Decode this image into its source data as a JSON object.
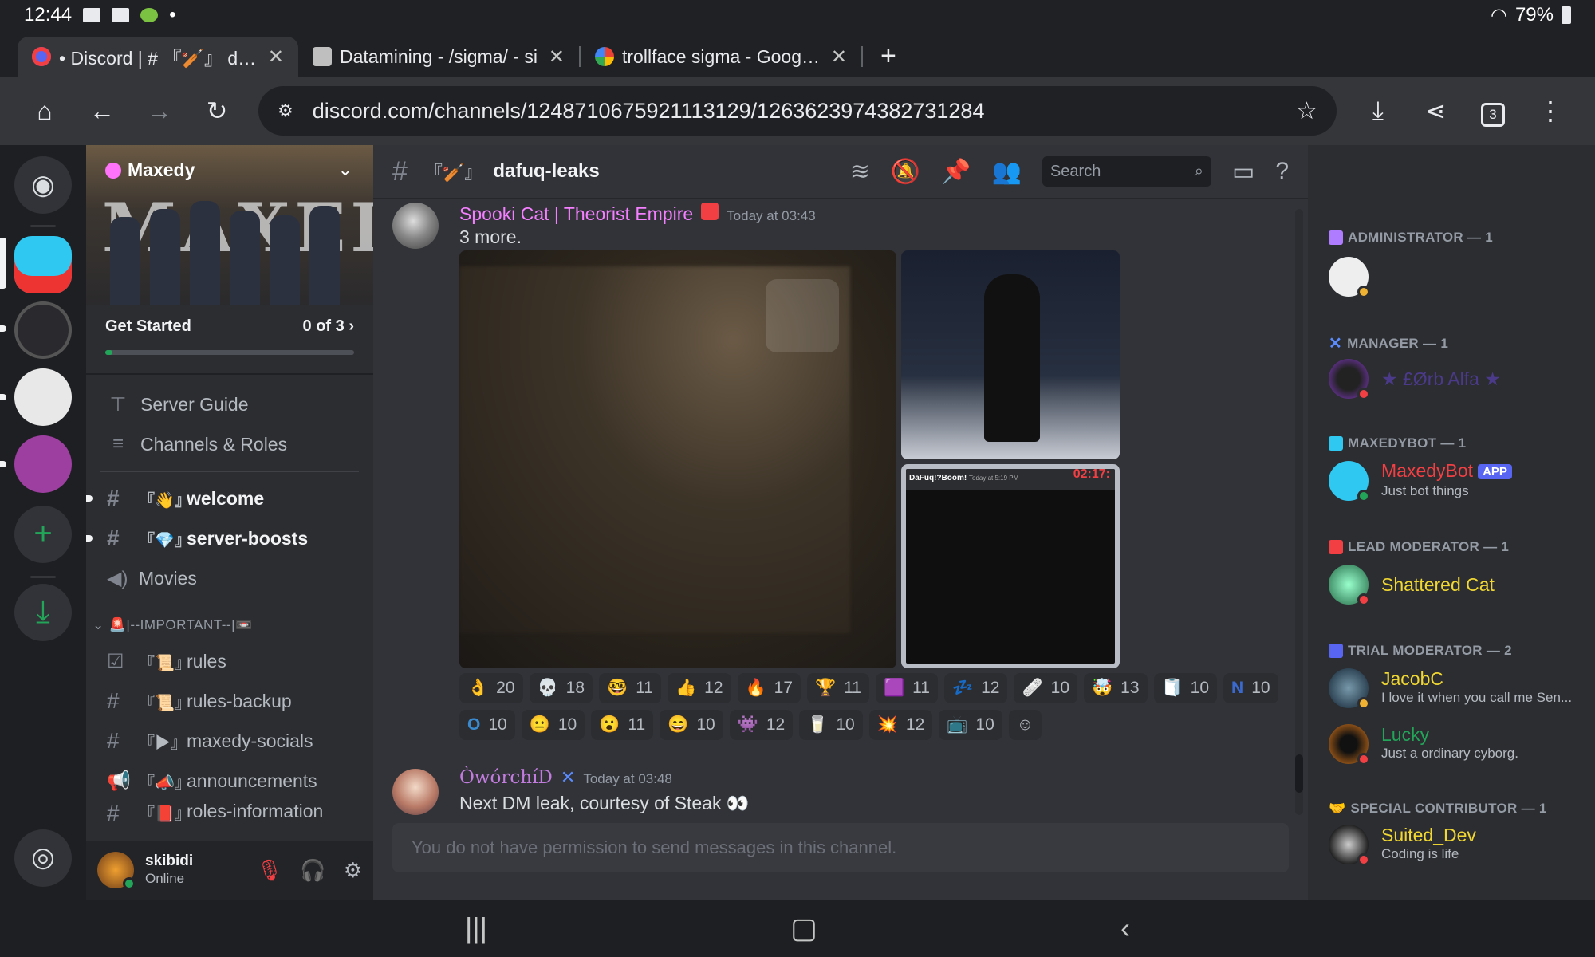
{
  "status_bar": {
    "time": "12:44",
    "battery": "79%"
  },
  "browser": {
    "tabs": [
      {
        "title": "• Discord | # 『🏏』 dafuq",
        "active": true
      },
      {
        "title": "Datamining - /sigma/ - si",
        "active": false
      },
      {
        "title": "trollface sigma - Google S",
        "active": false
      }
    ],
    "new_tab": "+",
    "url": "discord.com/channels/1248710675921113129/1263623974382731284",
    "tab_count": "3"
  },
  "server": {
    "name": "Maxedy",
    "banner_text": "MAXEDY",
    "get_started": {
      "label": "Get Started",
      "progress_text": "0 of 3",
      "progress": 0.03
    },
    "shortcuts": [
      {
        "label": "Server Guide",
        "icon": "signpost-icon"
      },
      {
        "label": "Channels & Roles",
        "icon": "channel-browse-icon"
      }
    ],
    "channels_top": [
      {
        "emoji": "『👋』",
        "name": "welcome",
        "unread": true
      },
      {
        "emoji": "『💎』",
        "name": "server-boosts",
        "unread": true
      },
      {
        "emoji": "",
        "name": "Movies",
        "voice": true
      }
    ],
    "category": "🚨|--IMPORTANT--|📼",
    "channels_important": [
      {
        "emoji": "『📜』",
        "name": "rules"
      },
      {
        "emoji": "『📜』",
        "name": "rules-backup"
      },
      {
        "emoji": "『▶』",
        "name": "maxedy-socials"
      },
      {
        "emoji": "『📣』",
        "name": "announcements"
      },
      {
        "emoji": "『📕』",
        "name": "roles-information"
      }
    ]
  },
  "user": {
    "name": "skibidi",
    "status": "Online"
  },
  "channel": {
    "emoji": "『🏏』",
    "name": "dafuq-leaks",
    "search_placeholder": "Search"
  },
  "messages": [
    {
      "author": "Spooki Cat | Theorist Empire",
      "author_color": "#f47fff",
      "time": "Today at 03:43",
      "text": "3 more."
    },
    {
      "author": "ÒwórchíD",
      "author_color": "#c27cde",
      "time": "Today at 03:48",
      "text": "Next DM leak, courtesy of Steak 👀"
    }
  ],
  "embed_caption": {
    "author": "DaFuq!?Boom!",
    "time": "Today at 5:19 PM",
    "timer": "02:17:"
  },
  "reactions": [
    {
      "emoji": "👌",
      "count": "20"
    },
    {
      "emoji": "💀",
      "count": "18"
    },
    {
      "emoji": "🤓",
      "count": "11"
    },
    {
      "emoji": "👍",
      "count": "12"
    },
    {
      "emoji": "🔥",
      "count": "17"
    },
    {
      "emoji": "🏆",
      "count": "11"
    },
    {
      "emoji": "🟪",
      "count": "11"
    },
    {
      "emoji": "💤",
      "count": "12"
    },
    {
      "emoji": "🩹",
      "count": "10"
    },
    {
      "emoji": "🤯",
      "count": "13"
    },
    {
      "emoji": "🧻",
      "count": "10"
    },
    {
      "emoji": "N",
      "count": "10"
    },
    {
      "emoji": "O",
      "count": "10"
    },
    {
      "emoji": "😐",
      "count": "10"
    },
    {
      "emoji": "😮",
      "count": "11"
    },
    {
      "emoji": "😄",
      "count": "10"
    },
    {
      "emoji": "👾",
      "count": "12"
    },
    {
      "emoji": "🥛",
      "count": "10"
    },
    {
      "emoji": "💥",
      "count": "12"
    },
    {
      "emoji": "📺",
      "count": "10"
    }
  ],
  "input_placeholder": "You do not have permission to send messages in this channel.",
  "members": [
    {
      "role": "ADMINISTRATOR — 1",
      "name": "",
      "sub": "",
      "name_color": "#3a2f55"
    },
    {
      "role": "MANAGER — 1",
      "name": "★ £Ørb Alfa ★",
      "sub": "",
      "name_color": "#4b3a8a"
    },
    {
      "role": "MAXEDYBOT — 1",
      "name": "MaxedyBot",
      "tag": "APP",
      "sub": "Just bot things",
      "name_color": "#f23f43"
    },
    {
      "role": "LEAD MODERATOR — 1",
      "name": "Shattered Cat",
      "sub": "",
      "name_color": "#f0d732"
    },
    {
      "role": "TRIAL MODERATOR — 2",
      "name": "JacobC",
      "sub": "I love it when you call me Sen...",
      "name_color": "#f0d732"
    },
    {
      "role": "",
      "name": "Lucky",
      "sub": "Just a ordinary cyborg.",
      "name_color": "#23a559"
    },
    {
      "role": "SPECIAL CONTRIBUTOR — 1",
      "name": "Suited_Dev",
      "sub": "Coding is life",
      "name_color": "#f0d732"
    }
  ],
  "colors": {
    "accent": "#5865f2",
    "online": "#23a559",
    "dnd": "#f23f43",
    "idle": "#f0b232"
  }
}
